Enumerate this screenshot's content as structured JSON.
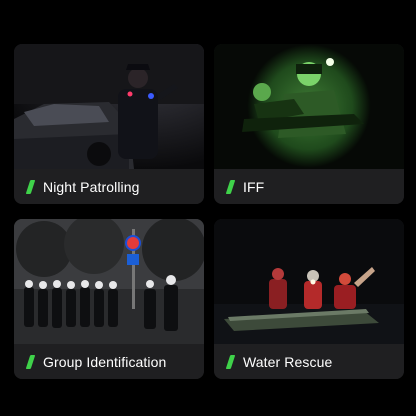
{
  "accent_color": "#3fd24a",
  "cards": [
    {
      "label": "Night Patrolling",
      "image": "officer-at-car-at-night"
    },
    {
      "label": "IFF",
      "image": "night-vision-soldiers-green"
    },
    {
      "label": "Group Identification",
      "image": "police-group-marching"
    },
    {
      "label": "Water Rescue",
      "image": "rescue-team-on-boat"
    }
  ]
}
